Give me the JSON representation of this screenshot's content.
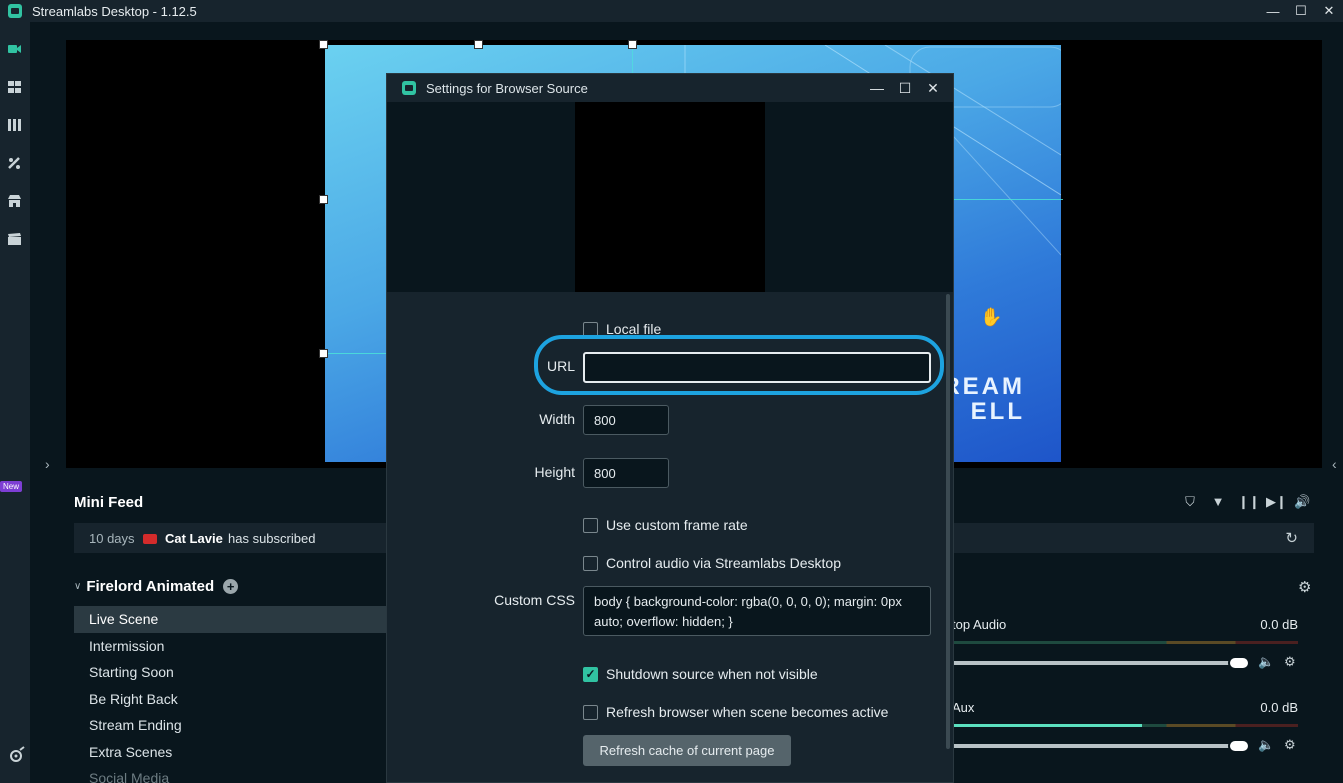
{
  "window": {
    "title": "Streamlabs Desktop - 1.12.5",
    "minimize": "—",
    "maximize": "☐",
    "close": "✕"
  },
  "nav": {
    "new_badge": "New"
  },
  "canvas": {
    "text_line1": "REAM",
    "text_line2": "ELL"
  },
  "mini_feed": {
    "title": "Mini Feed",
    "event": {
      "time": "10 days",
      "name": "Cat Lavie",
      "action": "has subscribed"
    }
  },
  "scenes": {
    "collection": "Firelord Animated",
    "items": [
      "Live Scene",
      "Intermission",
      "Starting Soon",
      "Be Right Back",
      "Stream Ending",
      "Extra Scenes",
      "Social Media"
    ]
  },
  "mixer": {
    "rows": [
      {
        "label": "top Audio",
        "db": "0.0 dB",
        "level": 0
      },
      {
        "label": "Aux",
        "db": "0.0 dB",
        "level": 0.55
      }
    ]
  },
  "dialog": {
    "title": "Settings for Browser Source",
    "local_file_label": "Local file",
    "url_label": "URL",
    "url_value": "",
    "width_label": "Width",
    "width_value": "800",
    "height_label": "Height",
    "height_value": "800",
    "custom_frame_rate_label": "Use custom frame rate",
    "control_audio_label": "Control audio via Streamlabs Desktop",
    "custom_css_label": "Custom CSS",
    "custom_css_value": "body { background-color: rgba(0, 0, 0, 0); margin: 0px auto; overflow: hidden; }",
    "shutdown_label": "Shutdown source when not visible",
    "shutdown_checked": true,
    "refresh_scene_label": "Refresh browser when scene becomes active",
    "refresh_cache_button": "Refresh cache of current page"
  },
  "colors": {
    "accent": "#31c3a2",
    "highlight": "#1da3e0",
    "background": "#09161d",
    "panel": "#17242d"
  }
}
